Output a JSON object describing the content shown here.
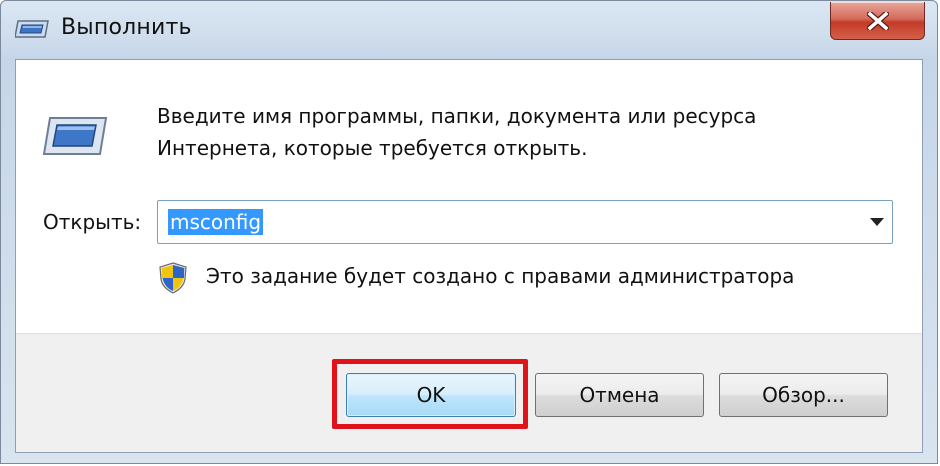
{
  "window": {
    "title": "Выполнить",
    "title_icon": "run-app-icon",
    "close_icon": "close-icon",
    "close_button_color": "#c23b26"
  },
  "dialog": {
    "description_line1": "Введите имя программы, папки, документа или ресурса",
    "description_line2": "Интернета, которые требуется открыть.",
    "program_icon": "run-program-icon",
    "open_label": "Открыть:",
    "open_value": "msconfig",
    "dropdown_icon": "chevron-down-icon",
    "admin_icon": "uac-shield-icon",
    "admin_note": "Это задание будет создано с правами администратора"
  },
  "buttons": {
    "ok": "OK",
    "cancel": "Отмена",
    "browse": "Обзор..."
  },
  "annotation": {
    "highlight_color": "#e0121a",
    "highlighted_element": "ok-button"
  }
}
